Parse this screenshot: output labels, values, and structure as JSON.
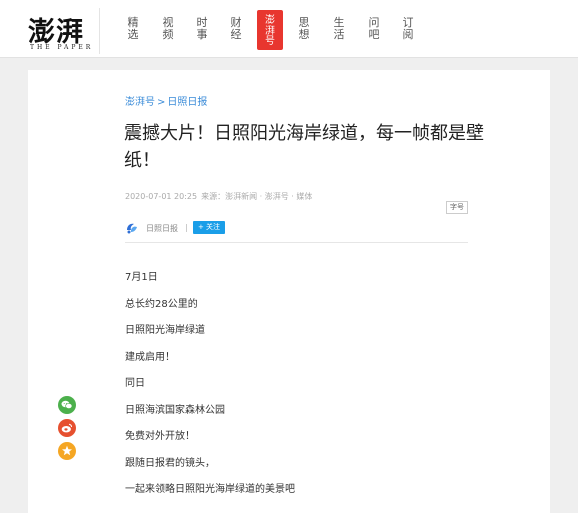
{
  "header": {
    "logo": {
      "main": "澎湃",
      "sub": "THE PAPER"
    },
    "nav": [
      {
        "label": "精选",
        "chars": [
          "精",
          "选"
        ]
      },
      {
        "label": "视频",
        "chars": [
          "视",
          "频"
        ]
      },
      {
        "label": "时事",
        "chars": [
          "时",
          "事"
        ]
      },
      {
        "label": "财经",
        "chars": [
          "财",
          "经"
        ]
      },
      {
        "label": "澎湃号",
        "chars": [
          "澎",
          "湃",
          "号"
        ],
        "active": true
      },
      {
        "label": "思想",
        "chars": [
          "思",
          "想"
        ]
      },
      {
        "label": "生活",
        "chars": [
          "生",
          "活"
        ]
      },
      {
        "label": "问吧",
        "chars": [
          "问",
          "吧"
        ]
      },
      {
        "label": "订阅",
        "chars": [
          "订",
          "阅"
        ]
      }
    ]
  },
  "article": {
    "breadcrumb": {
      "part1": "澎湃号",
      "separator": ">",
      "part2": "日照日报"
    },
    "title": "震撼大片！日照阳光海岸绿道，每一帧都是壁纸！",
    "meta": {
      "datetime": "2020-07-01 20:25",
      "source": "来源：澎湃新闻 · 澎湃号 · 媒体"
    },
    "font_size_button": "字号",
    "author": {
      "name": "日照日报",
      "follow_label": "+ 关注"
    },
    "body": [
      "7月1日",
      "总长约28公里的",
      "日照阳光海岸绿道",
      "建成启用！",
      "同日",
      "日照海滨国家森林公园",
      "免费对外开放！",
      "跟随日报君的镜头，",
      "一起来领略日照阳光海岸绿道的美景吧"
    ]
  },
  "share": [
    {
      "icon": "wechat-icon",
      "color": "#4cb04c"
    },
    {
      "icon": "weibo-icon",
      "color": "#e6502f"
    },
    {
      "icon": "qzone-icon",
      "color": "#f5a623"
    }
  ]
}
